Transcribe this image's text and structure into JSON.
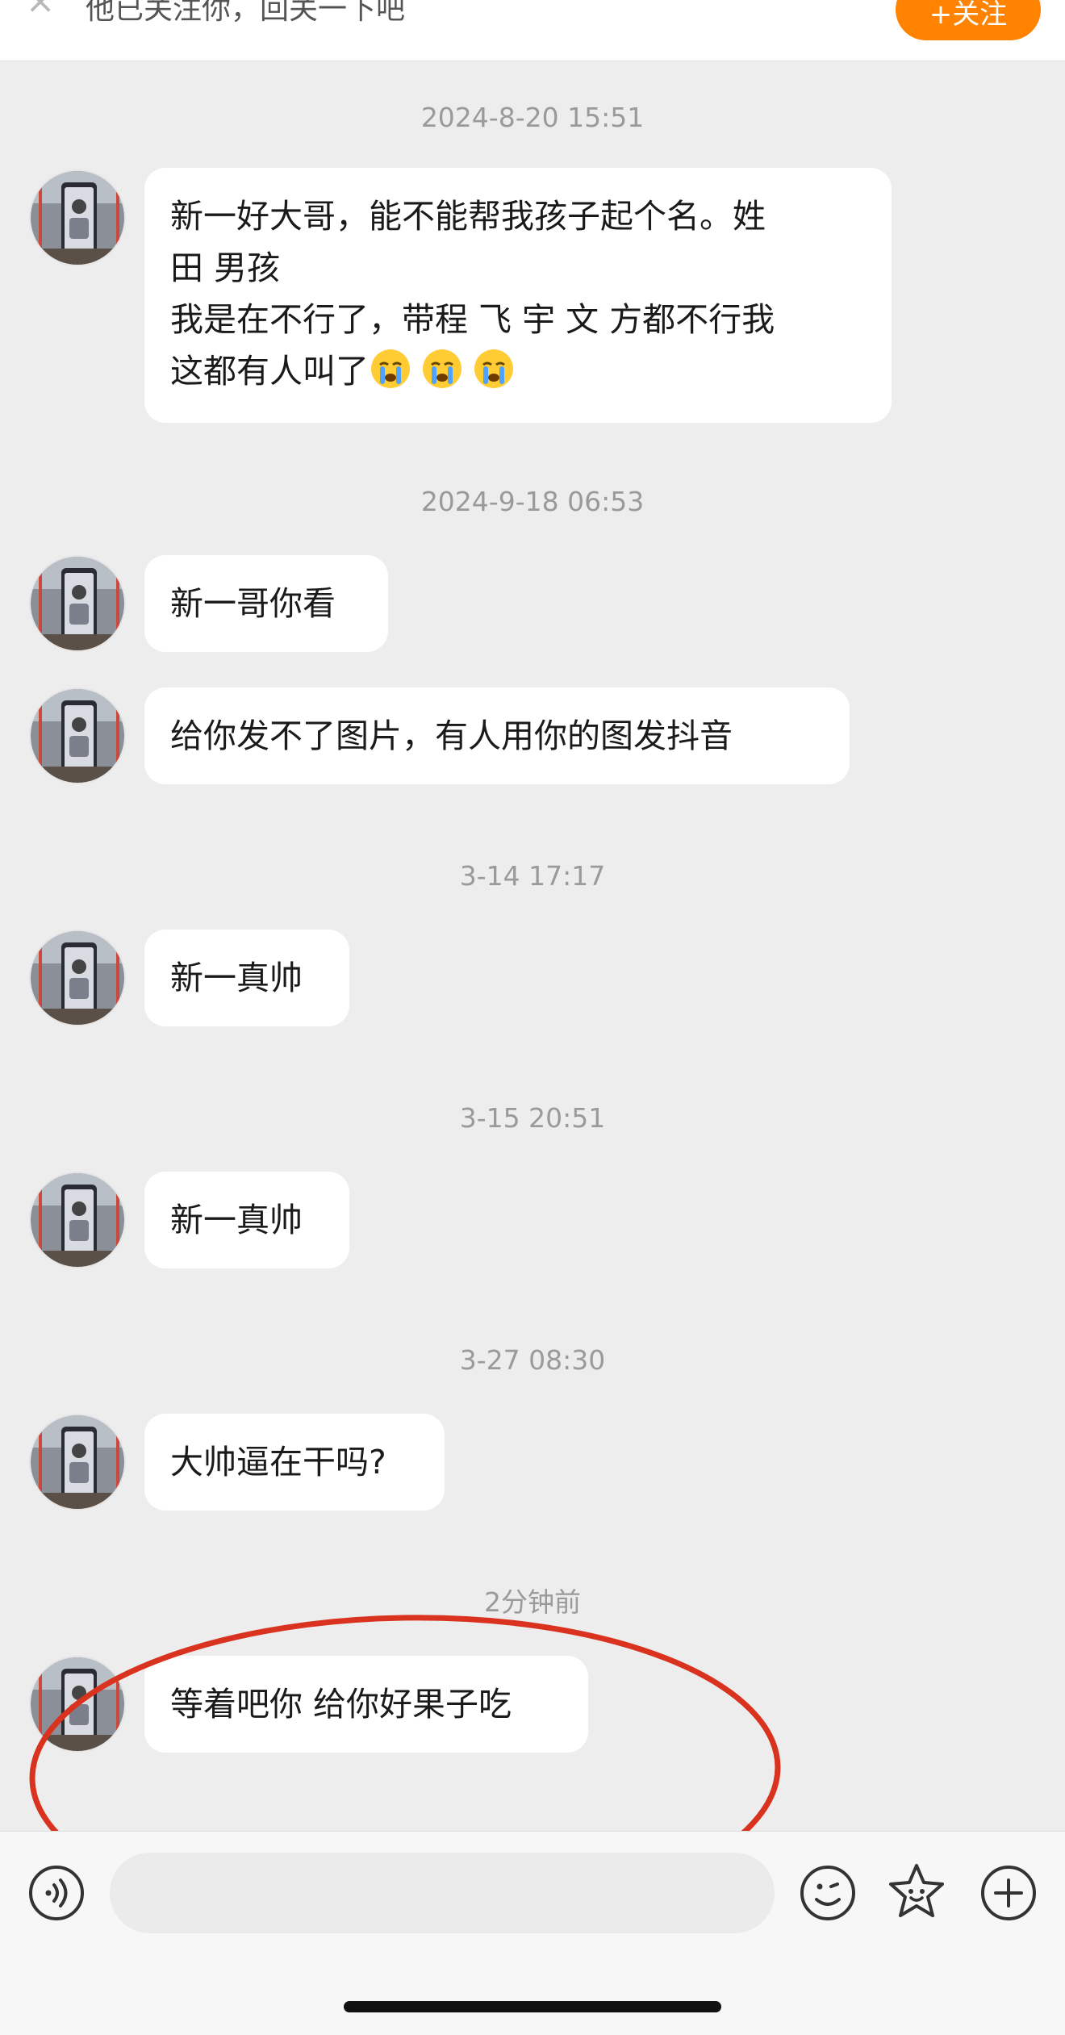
{
  "banner": {
    "close_symbol": "×",
    "text": "他已关注你，回关一下吧",
    "follow_label": "+关注"
  },
  "messages": [
    {
      "timestamp": "2024-8-20 15:51",
      "lines": [
        "新一好大哥，能不能帮我孩子起个名。姓",
        "田 男孩",
        "我是在不行了，带程 飞 宇 文 方都不行我",
        "这都有人叫了"
      ],
      "trailing_emoji": "crying-face"
    },
    {
      "timestamp": "2024-9-18 06:53",
      "lines": [
        "新一哥你看"
      ]
    },
    {
      "lines": [
        "给你发不了图片，有人用你的图发抖音"
      ]
    },
    {
      "timestamp": "3-14 17:17",
      "lines": [
        "新一真帅"
      ]
    },
    {
      "timestamp": "3-15 20:51",
      "lines": [
        "新一真帅"
      ]
    },
    {
      "timestamp": "3-27 08:30",
      "lines": [
        "大帅逼在干吗?"
      ]
    },
    {
      "timestamp": "2分钟前",
      "lines": [
        "等着吧你 给你好果子吃"
      ]
    }
  ],
  "colors": {
    "background": "#ededed",
    "bubble": "#ffffff",
    "accent": "#ff8200",
    "annotation": "#d9321e"
  },
  "input": {
    "placeholder": "",
    "value": ""
  },
  "icons": {
    "voice": "voice-icon",
    "emoji": "emoji-icon",
    "sticker": "sticker-icon",
    "plus": "plus-icon"
  }
}
